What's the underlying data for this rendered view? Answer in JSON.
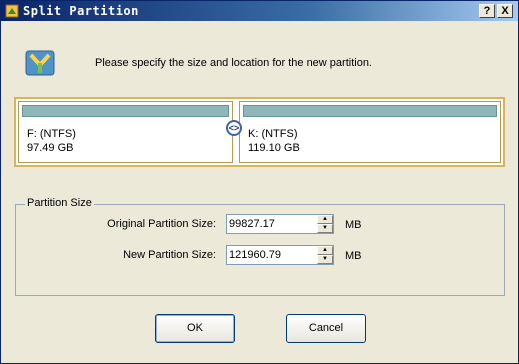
{
  "window": {
    "title": "Split Partition",
    "help_label": "?",
    "close_label": "X"
  },
  "prompt": "Please specify the size and location for the new partition.",
  "partitions": [
    {
      "name": "F: (NTFS)",
      "size": "97.49 GB"
    },
    {
      "name": "K: (NTFS)",
      "size": "119.10 GB"
    }
  ],
  "divider_glyph": "<>",
  "partition_size": {
    "group_label": "Partition Size",
    "original_label": "Original Partition Size:",
    "original_value": "99827.17",
    "new_label": "New Partition Size:",
    "new_value": "121960.79",
    "unit": "MB"
  },
  "buttons": {
    "ok": "OK",
    "cancel": "Cancel"
  },
  "colors": {
    "titlebar": "#0a246a",
    "partition_strip": "#8fb7ba",
    "partition_border": "#d8b45a"
  }
}
